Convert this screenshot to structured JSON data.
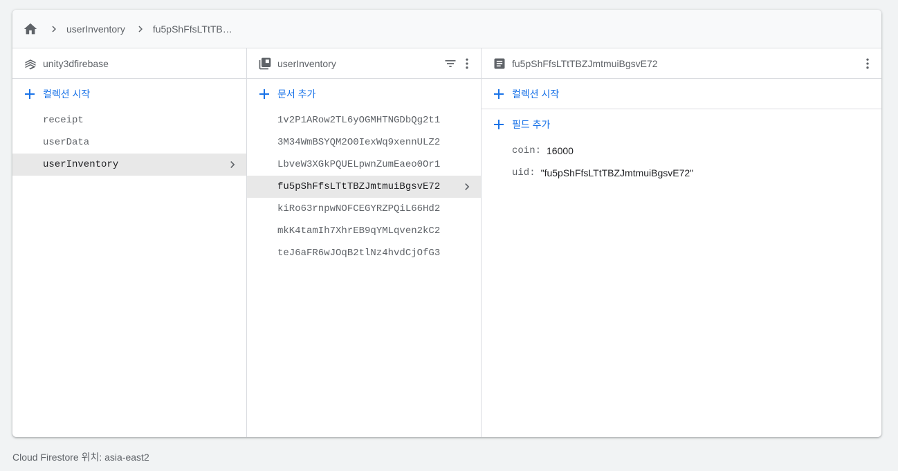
{
  "breadcrumb": {
    "items": [
      "userInventory",
      "fu5pShFfsLTtTB…"
    ]
  },
  "column1": {
    "title": "unity3dfirebase",
    "add_label": "컬렉션 시작",
    "items": [
      "receipt",
      "userData",
      "userInventory"
    ],
    "selected": "userInventory"
  },
  "column2": {
    "title": "userInventory",
    "add_label": "문서 추가",
    "items": [
      "1v2P1ARow2TL6yOGMHTNGDbQg2t1",
      "3M34WmBSYQM2O0IexWq9xennULZ2",
      "LbveW3XGkPQUELpwnZumEaeo0Or1",
      "fu5pShFfsLTtTBZJmtmuiBgsvE72",
      "kiRo63rnpwNOFCEGYRZPQiL66Hd2",
      "mkK4tamIh7XhrEB9qYMLqven2kC2",
      "teJ6aFR6wJOqB2tlNz4hvdCjOfG3"
    ],
    "selected": "fu5pShFfsLTtTBZJmtmuiBgsvE72"
  },
  "column3": {
    "title": "fu5pShFfsLTtTBZJmtmuiBgsvE72",
    "add_collection_label": "컬렉션 시작",
    "add_field_label": "필드 추가",
    "fields": [
      {
        "key": "coin",
        "value": "16000"
      },
      {
        "key": "uid",
        "value": "\"fu5pShFfsLTtTBZJmtmuiBgsvE72\""
      }
    ]
  },
  "footer": {
    "text": "Cloud Firestore 위치: asia-east2"
  },
  "colors": {
    "accent": "#1a73e8",
    "selected_bg": "#e8e8e8",
    "border": "#dadce0"
  },
  "icons": {
    "home": "home-icon",
    "chevron": "chevron-right-icon",
    "database": "firestore-database-icon",
    "collection": "collection-icon",
    "document": "document-icon",
    "filter": "filter-icon",
    "more": "more-vert-icon",
    "add": "plus-icon"
  }
}
